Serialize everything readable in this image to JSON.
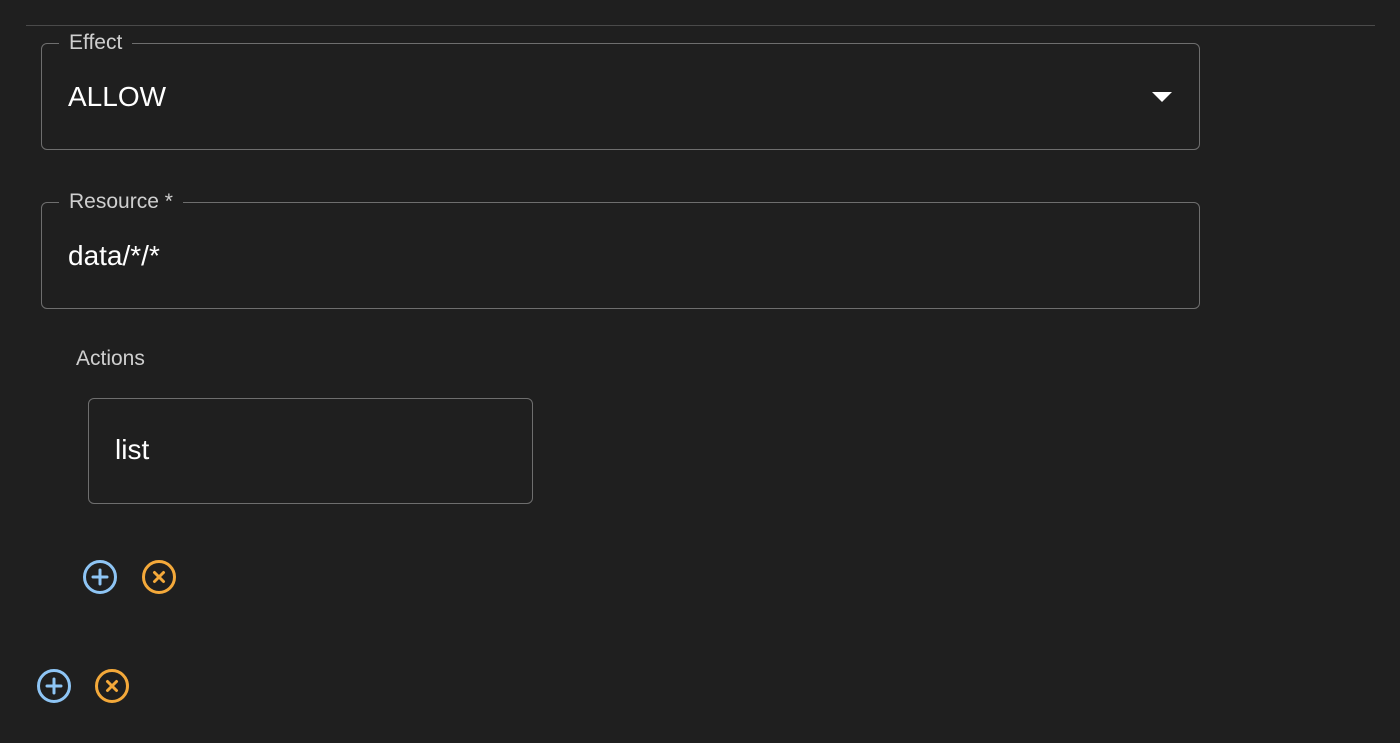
{
  "effect": {
    "label": "Effect",
    "value": "ALLOW"
  },
  "resource": {
    "label": "Resource *",
    "value": "data/*/*"
  },
  "actions": {
    "label": "Actions",
    "items": [
      {
        "value": "list"
      }
    ]
  },
  "icons": {
    "add": "add-circle-icon",
    "remove": "cancel-circle-icon"
  },
  "colors": {
    "background": "#1f1f1f",
    "add_icon": "#8ec5f5",
    "remove_icon": "#f4a93a",
    "border": "#6e6e6e"
  }
}
